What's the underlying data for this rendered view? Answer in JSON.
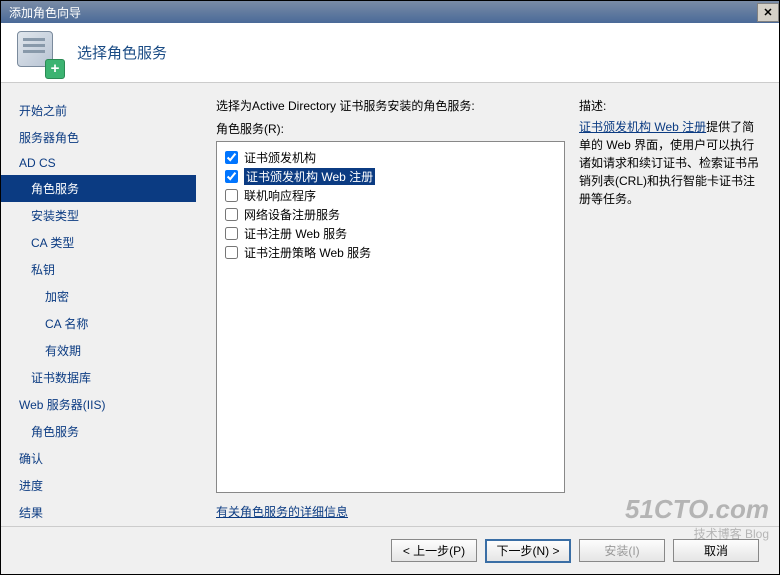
{
  "window": {
    "title": "添加角色向导"
  },
  "header": {
    "title": "选择角色服务"
  },
  "sidebar": {
    "items": [
      {
        "label": "开始之前",
        "indent": 0
      },
      {
        "label": "服务器角色",
        "indent": 0
      },
      {
        "label": "AD CS",
        "indent": 0
      },
      {
        "label": "角色服务",
        "indent": 1,
        "selected": true
      },
      {
        "label": "安装类型",
        "indent": 1
      },
      {
        "label": "CA 类型",
        "indent": 1
      },
      {
        "label": "私钥",
        "indent": 1
      },
      {
        "label": "加密",
        "indent": 2
      },
      {
        "label": "CA 名称",
        "indent": 2
      },
      {
        "label": "有效期",
        "indent": 2
      },
      {
        "label": "证书数据库",
        "indent": 1
      },
      {
        "label": "Web 服务器(IIS)",
        "indent": 0
      },
      {
        "label": "角色服务",
        "indent": 1
      },
      {
        "label": "确认",
        "indent": 0
      },
      {
        "label": "进度",
        "indent": 0
      },
      {
        "label": "结果",
        "indent": 0
      }
    ]
  },
  "content": {
    "instruction": "选择为Active Directory 证书服务安装的角色服务:",
    "list_label": "角色服务(R):",
    "role_services": [
      {
        "label": "证书颁发机构",
        "checked": true,
        "highlight": false
      },
      {
        "label": "证书颁发机构 Web 注册",
        "checked": true,
        "highlight": true
      },
      {
        "label": "联机响应程序",
        "checked": false,
        "highlight": false
      },
      {
        "label": "网络设备注册服务",
        "checked": false,
        "highlight": false
      },
      {
        "label": "证书注册 Web 服务",
        "checked": false,
        "highlight": false
      },
      {
        "label": "证书注册策略 Web 服务",
        "checked": false,
        "highlight": false
      }
    ],
    "more_info": "有关角色服务的详细信息"
  },
  "description": {
    "title": "描述:",
    "link_text": "证书颁发机构 Web 注册",
    "body": "提供了简单的 Web 界面，使用户可以执行诸如请求和续订证书、检索证书吊销列表(CRL)和执行智能卡证书注册等任务。"
  },
  "footer": {
    "back": "< 上一步(P)",
    "next": "下一步(N) >",
    "install": "安装(I)",
    "cancel": "取消"
  },
  "watermark": {
    "main": "51CTO.com",
    "sub": "技术博客 Blog"
  }
}
